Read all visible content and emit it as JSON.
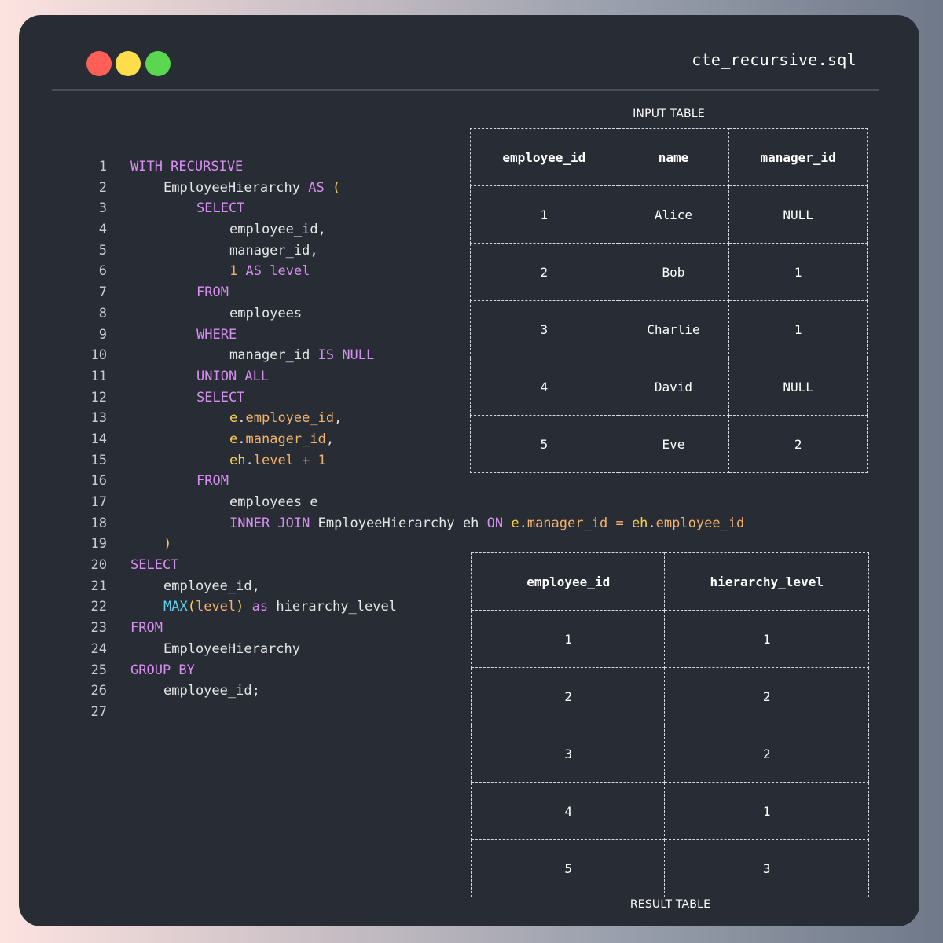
{
  "window": {
    "filename": "cte_recursive.sql",
    "buttons": {
      "close_color": "#fe5f57",
      "minimize_color": "#fedd4a",
      "maximize_color": "#5ad74e"
    }
  },
  "editor": {
    "line_numbers": [
      "1",
      "2",
      "3",
      "4",
      "5",
      "6",
      "7",
      "8",
      "9",
      "10",
      "11",
      "12",
      "13",
      "14",
      "15",
      "16",
      "17",
      "18",
      "19",
      "20",
      "21",
      "22",
      "23",
      "24",
      "25",
      "26",
      "27"
    ],
    "tokens": {
      "with_recursive": "WITH RECURSIVE",
      "cte_name": "EmployeeHierarchy",
      "as": "AS",
      "open_paren": "(",
      "close_paren": ")",
      "select": "SELECT",
      "employee_id_comma": "employee_id,",
      "manager_id_comma": "manager_id,",
      "one": "1",
      "level": "level",
      "from": "FROM",
      "employees": "employees",
      "where": "WHERE",
      "manager_id": "manager_id",
      "is_null": "IS NULL",
      "union_all": "UNION ALL",
      "e": "e",
      "eh": "eh",
      "dot": ".",
      "employee_id": "employee_id",
      "comma": ",",
      "plus": "+",
      "employees_e": "employees e",
      "inner_join": "INNER JOIN",
      "on": "ON",
      "equals": "=",
      "max": "MAX",
      "as_lower": "as",
      "hierarchy_level": "hierarchy_level",
      "group_by": "GROUP BY",
      "employee_id_semicolon": "employee_id;"
    }
  },
  "input_table": {
    "caption": "INPUT TABLE",
    "headers": [
      "employee_id",
      "name",
      "manager_id"
    ],
    "rows": [
      [
        "1",
        "Alice",
        "NULL"
      ],
      [
        "2",
        "Bob",
        "1"
      ],
      [
        "3",
        "Charlie",
        "1"
      ],
      [
        "4",
        "David",
        "NULL"
      ],
      [
        "5",
        "Eve",
        "2"
      ]
    ]
  },
  "result_table": {
    "caption": "RESULT TABLE",
    "headers": [
      "employee_id",
      "hierarchy_level"
    ],
    "rows": [
      [
        "1",
        "1"
      ],
      [
        "2",
        "2"
      ],
      [
        "3",
        "2"
      ],
      [
        "4",
        "1"
      ],
      [
        "5",
        "3"
      ]
    ]
  }
}
